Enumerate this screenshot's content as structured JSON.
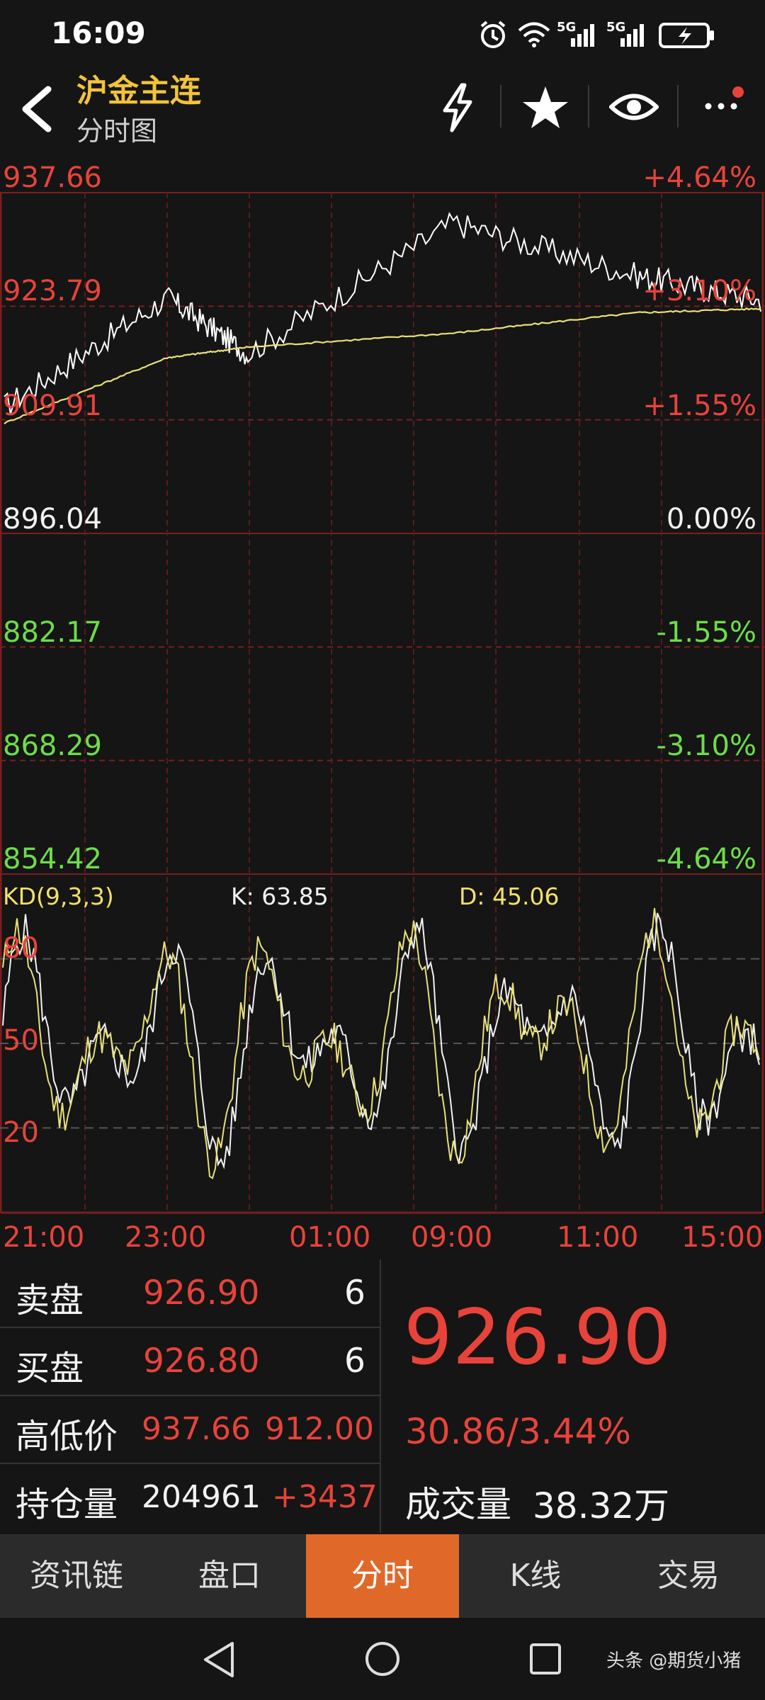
{
  "status_bar": {
    "time": "16:09",
    "signal_1": "5G",
    "signal_2": "5G"
  },
  "header": {
    "title": "沪金主连",
    "subtitle": "分时图",
    "icons": [
      "back-arrow-icon",
      "lightning-icon",
      "star-icon",
      "eye-icon",
      "more-icon"
    ]
  },
  "price_axis": {
    "left": [
      "937.66",
      "923.79",
      "909.91",
      "896.04",
      "882.17",
      "868.29",
      "854.42"
    ],
    "right": [
      "+4.64%",
      "+3.10%",
      "+1.55%",
      "0.00%",
      "-1.55%",
      "-3.10%",
      "-4.64%"
    ]
  },
  "kd": {
    "label": "KD(9,3,3)",
    "k": "K: 63.85",
    "d": "D: 45.06",
    "levels": [
      "80",
      "50",
      "20"
    ]
  },
  "time_axis": [
    "21:00",
    "23:00",
    "01:00",
    "09:00",
    "11:00",
    "15:00"
  ],
  "colors": {
    "red": "#e8433a",
    "green": "#6edc4a",
    "title": "#f2c33a",
    "accent": "#e0692a",
    "price_line": "#ffffff",
    "avg_line": "#e8e07a"
  },
  "chart_data": {
    "type": "line",
    "x": [
      "21:00",
      "23:00",
      "01:00",
      "09:00",
      "11:00",
      "15:00"
    ],
    "ylim": [
      854.42,
      937.66
    ],
    "series": [
      {
        "values": [
          911.5,
          924.8,
          918.0,
          934.0,
          927.5,
          924.5
        ]
      },
      {
        "values": [
          909.5,
          917.5,
          918.8,
          920.5,
          923.0,
          923.5
        ]
      }
    ]
  },
  "quote": {
    "rows": [
      {
        "label": "卖盘",
        "price": "926.90",
        "vol": "6"
      },
      {
        "label": "买盘",
        "price": "926.80",
        "vol": "6"
      }
    ],
    "hl_label": "高低价",
    "high": "937.66",
    "low": "912.00",
    "oi_label": "持仓量",
    "oi": "204961",
    "oi_change": "+3437",
    "last_price": "926.90",
    "change": "30.86/3.44%",
    "vol_label": "成交量",
    "volume": "38.32万"
  },
  "tabs": [
    "资讯链",
    "盘口",
    "分时",
    "K线",
    "交易"
  ],
  "watermark": "头条 @期货小猪"
}
